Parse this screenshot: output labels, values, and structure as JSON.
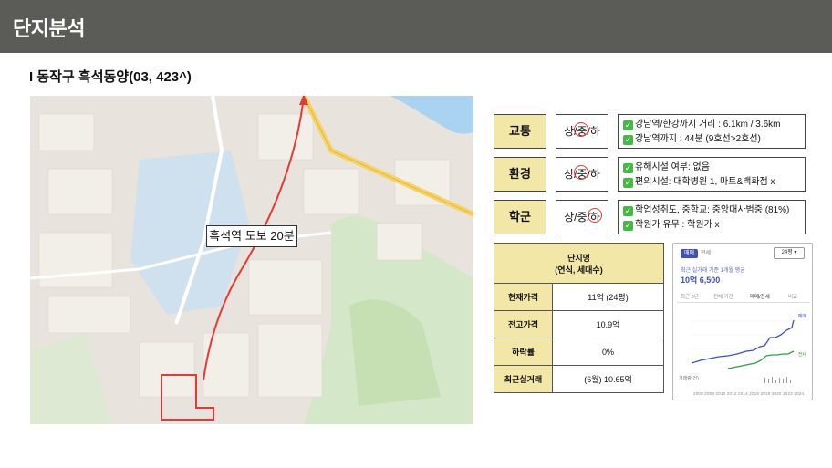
{
  "header": {
    "title": "단지분석"
  },
  "subtitle": "I 동작구 흑석동양(03, 423^)",
  "map": {
    "walk_label": "흑석역 도보 20분"
  },
  "ratings": [
    {
      "category": "교통",
      "grades": [
        "상",
        "중",
        "하"
      ],
      "selected": "중",
      "lines": [
        "강남역/한강까지 거리 : 6.1km / 3.6km",
        "강남역까지 : 44분 (9호선>2호선)"
      ]
    },
    {
      "category": "환경",
      "grades": [
        "상",
        "중",
        "하"
      ],
      "selected": "중",
      "lines": [
        "유해시설 여부: 없음",
        "편의시설: 대학병원 1, 마트&백화점 x"
      ]
    },
    {
      "category": "학군",
      "grades": [
        "상",
        "중",
        "하"
      ],
      "selected": "하",
      "lines": [
        "학업성취도, 중학교: 중앙대사범중 (81%)",
        "학원가 유무 : 학원가 x"
      ]
    }
  ],
  "table": {
    "header": "단지명\n(연식, 세대수)",
    "rows": [
      {
        "label": "현재가격",
        "value": "11억 (24평)"
      },
      {
        "label": "전고가격",
        "value": "10.9억"
      },
      {
        "label": "하락률",
        "value": "0%"
      },
      {
        "label": "최근실거래",
        "value": "(6월) 10.65억"
      }
    ]
  },
  "price_card": {
    "tabs": [
      "매매",
      "전세"
    ],
    "area": "24평 ▾",
    "avg_label": "최근 실거래 기준 1개월 평균",
    "avg_value": "10억 6,500",
    "subtabs": [
      "최근 3년",
      "전체 기간",
      "매매/전세",
      "비교"
    ],
    "legend_sale": "매매",
    "legend_jeonse": "전세",
    "volume_label": "거래량(건)",
    "years": "2008 2009 2010 2012 2014 2016 2018 2020 2022 2024"
  },
  "colors": {
    "header_bg": "#5b5b58",
    "label_bg": "#f3e7a8",
    "route": "#e53935",
    "sale": "#3f51b5",
    "jeonse": "#2e9e44"
  }
}
